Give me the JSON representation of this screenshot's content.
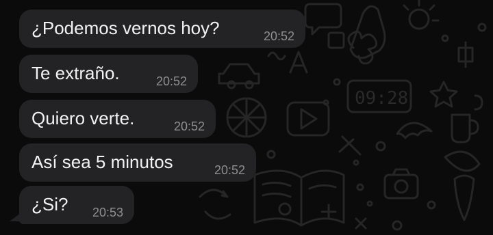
{
  "messages": [
    {
      "text": "¿Podemos vernos hoy?",
      "time": "20:52"
    },
    {
      "text": "Te extraño.",
      "time": "20:52"
    },
    {
      "text": "Quiero verte.",
      "time": "20:52"
    },
    {
      "text": "Así sea 5 minutos",
      "time": "20:52"
    },
    {
      "text": "¿Si?",
      "time": "20:53"
    }
  ],
  "wallpaper": {
    "clock_text": "09:28",
    "doodle_color": "#242424",
    "bubble_color": "#232325"
  }
}
